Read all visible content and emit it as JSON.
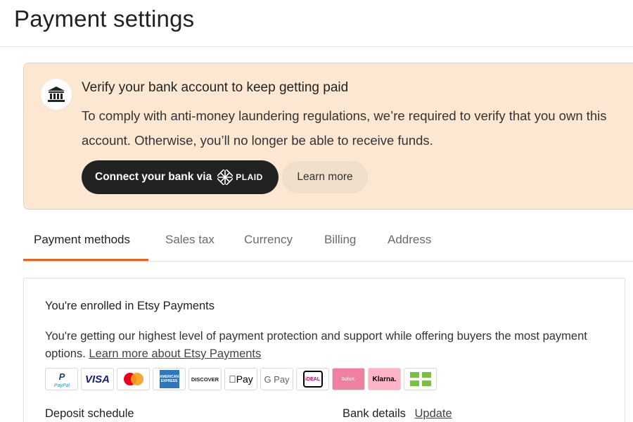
{
  "page": {
    "title": "Payment settings"
  },
  "banner": {
    "icon": "bank-icon",
    "heading": "Verify your bank account to keep getting paid",
    "body": "To comply with anti-money laundering regulations, we’re required to verify that you own this account. Otherwise, you’ll no longer be able to receive funds.",
    "connect_label": "Connect your bank via",
    "plaid_logo_text": "PLAID",
    "learn_more_label": "Learn more"
  },
  "tabs": [
    {
      "label": "Payment methods",
      "active": true
    },
    {
      "label": "Sales tax",
      "active": false
    },
    {
      "label": "Currency",
      "active": false
    },
    {
      "label": "Billing",
      "active": false
    },
    {
      "label": "Address",
      "active": false
    }
  ],
  "enrollment": {
    "heading": "You're enrolled in Etsy Payments",
    "body": "You're getting our highest level of payment protection and support while offering buyers the most payment options.",
    "link_label": "Learn more about Etsy Payments"
  },
  "payment_icons": [
    {
      "icon": "paypal-icon",
      "label": "PayPal"
    },
    {
      "icon": "visa-icon",
      "label": "VISA"
    },
    {
      "icon": "mastercard-icon",
      "label": ""
    },
    {
      "icon": "amex-icon",
      "label": "AMERICAN EXPRESS"
    },
    {
      "icon": "discover-icon",
      "label": "DISCOVER"
    },
    {
      "icon": "apple-pay-icon",
      "label": "Pay"
    },
    {
      "icon": "google-pay-icon",
      "label": "G Pay"
    },
    {
      "icon": "ideal-icon",
      "label": "iDEAL"
    },
    {
      "icon": "sofort-icon",
      "label": "Sofort."
    },
    {
      "icon": "klarna-icon",
      "label": "Klarna."
    },
    {
      "icon": "gift-card-icon",
      "label": ""
    }
  ],
  "deposit": {
    "label": "Deposit schedule"
  },
  "bank_details": {
    "label": "Bank details",
    "update_label": "Update"
  },
  "colors": {
    "accent": "#e8621d",
    "banner_bg": "#fce7d3",
    "dark_button": "#222222"
  }
}
